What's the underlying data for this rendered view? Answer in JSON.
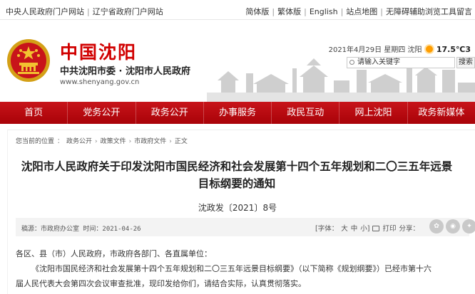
{
  "topbar": {
    "left_links": [
      "中央人民政府门户网站",
      "辽宁省政府门户网站"
    ],
    "right_links": [
      "简体版",
      "繁体版",
      "English",
      "站点地图",
      "无障碍辅助浏览工具留言"
    ]
  },
  "header": {
    "title": "中国沈阳",
    "subtitle": "中共沈阳市委 · 沈阳市人民政府",
    "url": "www.shenyang.gov.cn",
    "date": "2021年4月29日 星期四",
    "city": "沈阳",
    "temperature": "17.5℃3",
    "search_placeholder": "请输入关键字",
    "search_button": "搜索"
  },
  "nav": {
    "items": [
      "首页",
      "党务公开",
      "政务公开",
      "办事服务",
      "政民互动",
      "网上沈阳",
      "政务新媒体"
    ]
  },
  "breadcrumb": {
    "label": "您当前的位置",
    "items": [
      "政务公开",
      "政策文件",
      "市政府文件",
      "正文"
    ]
  },
  "article": {
    "title_line1": "沈阳市人民政府关于印发沈阳市国民经济和社会发展第十四个五年规划和二〇三五年远景",
    "title_line2": "目标纲要的通知",
    "doc_number": "沈政发〔2021〕8号",
    "source": "稿源：市政府办公室 时间：2021-04-26",
    "font_label": "[字体：",
    "font_sizes": [
      "大",
      "中",
      "小]"
    ],
    "print_label": "打印",
    "share_label": "分享：",
    "para1": "各区、县（市）人民政府，市政府各部门、各直属单位：",
    "para2": "《沈阳市国民经济和社会发展第十四个五年规划和二〇三五年远景目标纲要》（以下简称《规划纲要》）已经市第十六",
    "para3": "届人民代表大会第四次会议审查批准，现印发给你们，请结合实际，认真贯彻落实。"
  },
  "colors": {
    "brand_red": "#d10000",
    "nav_red": "#b8080e"
  }
}
